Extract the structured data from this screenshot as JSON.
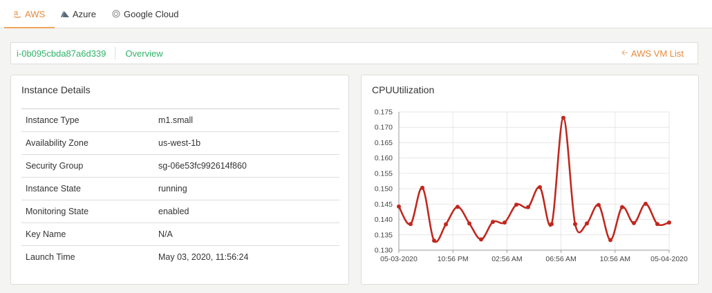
{
  "tabs": [
    {
      "label": "AWS",
      "icon": "amazon-icon",
      "active": true
    },
    {
      "label": "Azure",
      "icon": "azure-icon",
      "active": false
    },
    {
      "label": "Google Cloud",
      "icon": "google-cloud-icon",
      "active": false
    }
  ],
  "breadcrumb": {
    "instance_id": "i-0b095cbda87a6d339",
    "overview": "Overview",
    "back_label": "AWS VM List"
  },
  "instance_details": {
    "title": "Instance Details",
    "rows": [
      {
        "key": "Instance Type",
        "value": "m1.small"
      },
      {
        "key": "Availability Zone",
        "value": "us-west-1b"
      },
      {
        "key": "Security Group",
        "value": "sg-06e53fc992614f860"
      },
      {
        "key": "Instance State",
        "value": "running"
      },
      {
        "key": "Monitoring State",
        "value": "enabled"
      },
      {
        "key": "Key Name",
        "value": "N/A"
      },
      {
        "key": "Launch Time",
        "value": "May 03, 2020, 11:56:24"
      }
    ]
  },
  "colors": {
    "accent": "#e6893a",
    "link": "#2eb367",
    "series": "#c0281f"
  },
  "chart_data": {
    "type": "line",
    "title": "CPUUtilization",
    "xlabel": "",
    "ylabel": "",
    "ylim": [
      0.13,
      0.175
    ],
    "yticks": [
      "0.130",
      "0.135",
      "0.140",
      "0.145",
      "0.150",
      "0.155",
      "0.160",
      "0.165",
      "0.170",
      "0.175"
    ],
    "xticks": [
      "05-03-2020",
      "10:56 PM",
      "02:56 AM",
      "06:56 AM",
      "10:56 AM",
      "05-04-2020"
    ],
    "grid": true,
    "legend": "none",
    "series": [
      {
        "values": [
          0.1442,
          0.1385,
          0.1503,
          0.1331,
          0.1384,
          0.1441,
          0.1387,
          0.1335,
          0.1392,
          0.139,
          0.1448,
          0.144,
          0.1505,
          0.1385,
          0.1731,
          0.1385,
          0.1387,
          0.1447,
          0.1333,
          0.144,
          0.1388,
          0.1451,
          0.1385,
          0.139
        ]
      }
    ]
  }
}
